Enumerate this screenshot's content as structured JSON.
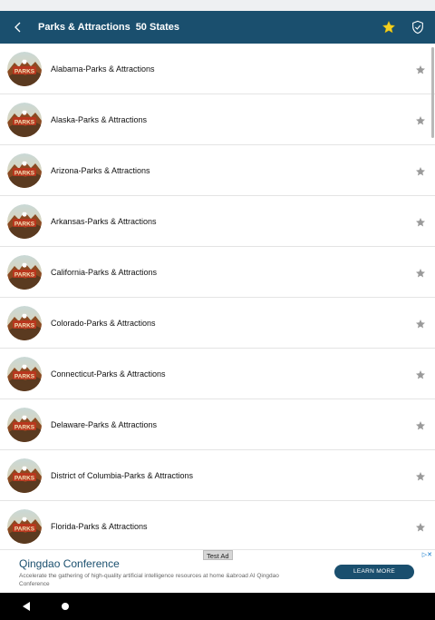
{
  "header": {
    "title": "Parks & Attractions",
    "subtitle": "50 States"
  },
  "icons": {
    "back": "back-arrow-icon",
    "favorites": "star-icon",
    "shield": "shield-check-icon",
    "row_favorite": "star-icon"
  },
  "colors": {
    "appbar": "#1a4f6e",
    "star_active": "#f5d020",
    "star_inactive": "#9a9a9a"
  },
  "list": {
    "items": [
      {
        "label": "Alabama-Parks & Attractions"
      },
      {
        "label": "Alaska-Parks & Attractions"
      },
      {
        "label": "Arizona-Parks & Attractions"
      },
      {
        "label": "Arkansas-Parks & Attractions"
      },
      {
        "label": "California-Parks & Attractions"
      },
      {
        "label": "Colorado-Parks & Attractions"
      },
      {
        "label": "Connecticut-Parks & Attractions"
      },
      {
        "label": "Delaware-Parks & Attractions"
      },
      {
        "label": "District of Columbia-Parks & Attractions"
      },
      {
        "label": "Florida-Parks & Attractions"
      }
    ]
  },
  "ad": {
    "tag": "Test Ad",
    "title": "Qingdao Conference",
    "description": "Accelerate the gathering of high-quality artificial intelligence resources at home &abroad AI Qingdao Conference",
    "button": "LEARN MORE"
  }
}
